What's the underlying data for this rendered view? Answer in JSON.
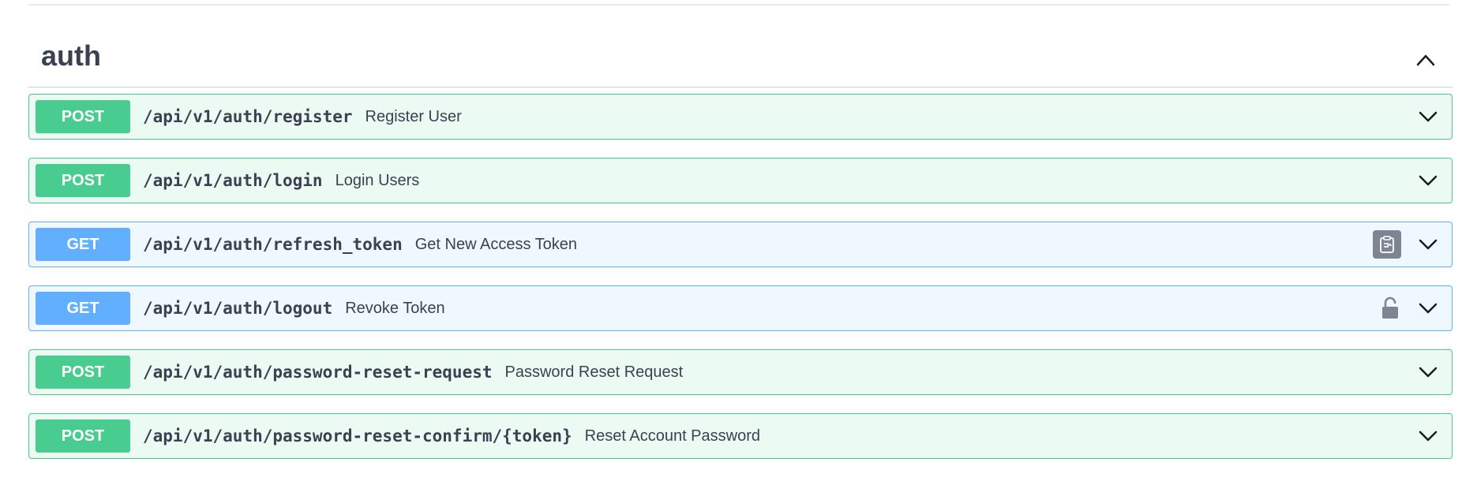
{
  "section": {
    "title": "auth",
    "toggle_icon": "chevron-up-icon"
  },
  "colors": {
    "post": "#49cc90",
    "get": "#61affe",
    "text": "#3b4151",
    "icon_gray": "#7d8492"
  },
  "operations": [
    {
      "method": "POST",
      "path": "/api/v1/auth/register",
      "summary": "Register User"
    },
    {
      "method": "POST",
      "path": "/api/v1/auth/login",
      "summary": "Login Users"
    },
    {
      "method": "GET",
      "path": "/api/v1/auth/refresh_token",
      "summary": "Get New Access Token",
      "extra_icon": "copy-to-clipboard-icon"
    },
    {
      "method": "GET",
      "path": "/api/v1/auth/logout",
      "summary": "Revoke Token",
      "extra_icon": "unlocked-lock-icon"
    },
    {
      "method": "POST",
      "path": "/api/v1/auth/password-reset-request",
      "summary": "Password Reset Request"
    },
    {
      "method": "POST",
      "path": "/api/v1/auth/password-reset-confirm/{token}",
      "summary": "Reset Account Password"
    }
  ]
}
